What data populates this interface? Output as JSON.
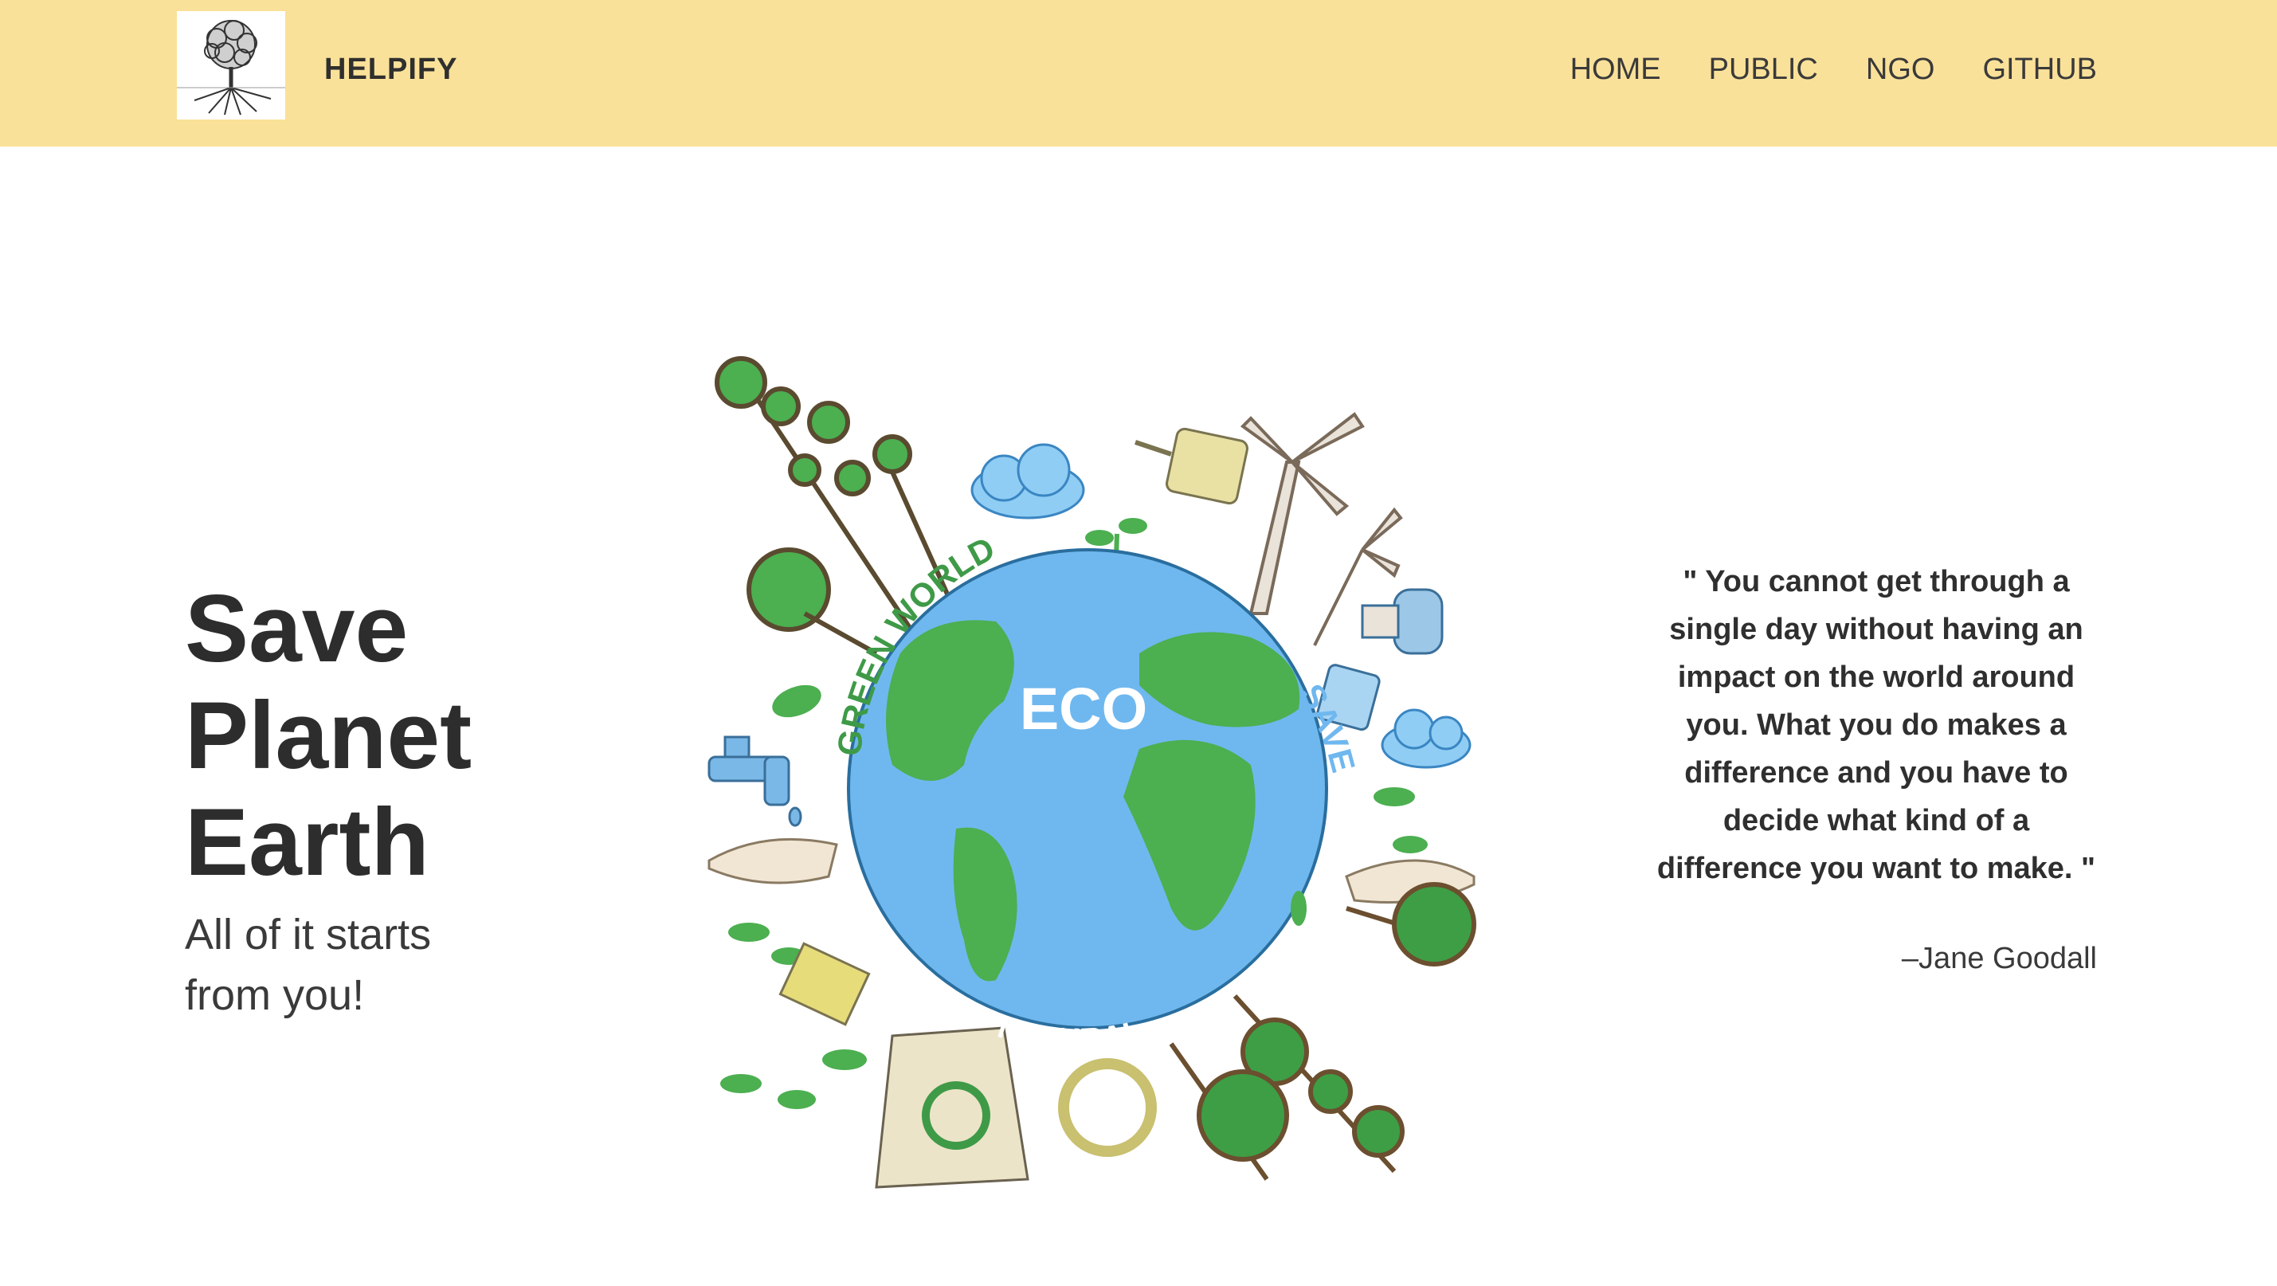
{
  "nav": {
    "brand": "HELPIFY",
    "links": [
      "HOME",
      "PUBLIC",
      "NGO",
      "GITHUB"
    ]
  },
  "hero": {
    "title_lines": [
      "Save",
      "Planet",
      "Earth"
    ],
    "subtitle": "All of it starts from you!"
  },
  "illustration": {
    "labels": {
      "top": "GREEN WORLD",
      "center": "ECO",
      "side": "SAVE",
      "bottom": "NATURAL"
    }
  },
  "quote": {
    "text": "\" You cannot get through a single day without having an impact on the world around you. What you do makes a difference and you have to decide what kind of a difference you want to make. \"",
    "author": "–Jane Goodall"
  },
  "colors": {
    "navbar_bg": "#fae199",
    "ocean": "#6fb8ef",
    "land": "#4caf50"
  }
}
